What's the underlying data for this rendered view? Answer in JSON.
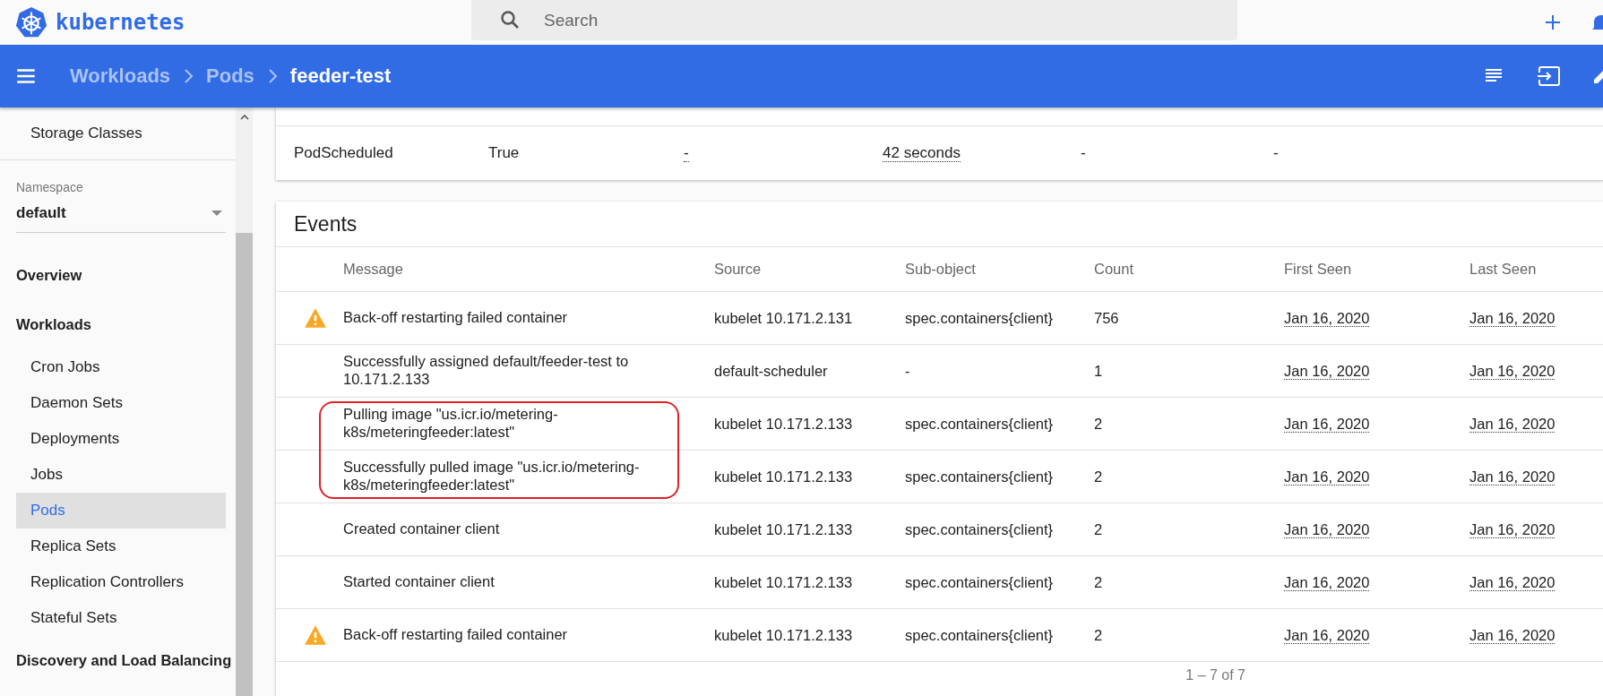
{
  "app": {
    "brand": "kubernetes"
  },
  "search": {
    "placeholder": "Search"
  },
  "breadcrumbs": [
    {
      "label": "Workloads",
      "current": false
    },
    {
      "label": "Pods",
      "current": false
    },
    {
      "label": "feeder-test",
      "current": true
    }
  ],
  "sidebar": {
    "items": [
      {
        "kind": "item",
        "label": "Storage Classes",
        "selected": false
      }
    ],
    "namespace": {
      "label": "Namespace",
      "value": "default"
    },
    "nav": [
      {
        "kind": "section",
        "label": "Overview",
        "selected": false
      },
      {
        "kind": "section",
        "label": "Workloads",
        "selected": false
      },
      {
        "kind": "item",
        "label": "Cron Jobs",
        "selected": false
      },
      {
        "kind": "item",
        "label": "Daemon Sets",
        "selected": false
      },
      {
        "kind": "item",
        "label": "Deployments",
        "selected": false
      },
      {
        "kind": "item",
        "label": "Jobs",
        "selected": false
      },
      {
        "kind": "item",
        "label": "Pods",
        "selected": true
      },
      {
        "kind": "item",
        "label": "Replica Sets",
        "selected": false
      },
      {
        "kind": "item",
        "label": "Replication Controllers",
        "selected": false
      },
      {
        "kind": "item",
        "label": "Stateful Sets",
        "selected": false
      },
      {
        "kind": "section",
        "label": "Discovery and Load Balancing",
        "selected": false
      }
    ]
  },
  "conditions": {
    "rows": [
      {
        "type": "PodScheduled",
        "status": "True",
        "last_probe": "-",
        "last_transition": "42 seconds",
        "reason": "-",
        "message": "-"
      }
    ]
  },
  "events": {
    "title": "Events",
    "columns": [
      "Message",
      "Source",
      "Sub-object",
      "Count",
      "First Seen",
      "Last Seen"
    ],
    "rows": [
      {
        "warning": true,
        "highlighted": false,
        "message": "Back-off restarting failed container",
        "source": "kubelet 10.171.2.131",
        "sub_object": "spec.containers{client}",
        "count": "756",
        "first_seen": "Jan 16, 2020",
        "last_seen": "Jan 16, 2020"
      },
      {
        "warning": false,
        "highlighted": false,
        "message": "Successfully assigned default/feeder-test to 10.171.2.133",
        "source": "default-scheduler",
        "sub_object": "-",
        "count": "1",
        "first_seen": "Jan 16, 2020",
        "last_seen": "Jan 16, 2020"
      },
      {
        "warning": false,
        "highlighted": true,
        "message": "Pulling image \"us.icr.io/metering-k8s/meteringfeeder:latest\"",
        "source": "kubelet 10.171.2.133",
        "sub_object": "spec.containers{client}",
        "count": "2",
        "first_seen": "Jan 16, 2020",
        "last_seen": "Jan 16, 2020"
      },
      {
        "warning": false,
        "highlighted": true,
        "message": "Successfully pulled image \"us.icr.io/metering-k8s/meteringfeeder:latest\"",
        "source": "kubelet 10.171.2.133",
        "sub_object": "spec.containers{client}",
        "count": "2",
        "first_seen": "Jan 16, 2020",
        "last_seen": "Jan 16, 2020"
      },
      {
        "warning": false,
        "highlighted": false,
        "message": "Created container client",
        "source": "kubelet 10.171.2.133",
        "sub_object": "spec.containers{client}",
        "count": "2",
        "first_seen": "Jan 16, 2020",
        "last_seen": "Jan 16, 2020"
      },
      {
        "warning": false,
        "highlighted": false,
        "message": "Started container client",
        "source": "kubelet 10.171.2.133",
        "sub_object": "spec.containers{client}",
        "count": "2",
        "first_seen": "Jan 16, 2020",
        "last_seen": "Jan 16, 2020"
      },
      {
        "warning": true,
        "highlighted": false,
        "message": "Back-off restarting failed container",
        "source": "kubelet 10.171.2.133",
        "sub_object": "spec.containers{client}",
        "count": "2",
        "first_seen": "Jan 16, 2020",
        "last_seen": "Jan 16, 2020"
      }
    ],
    "pagination": "1 – 7 of 7"
  }
}
